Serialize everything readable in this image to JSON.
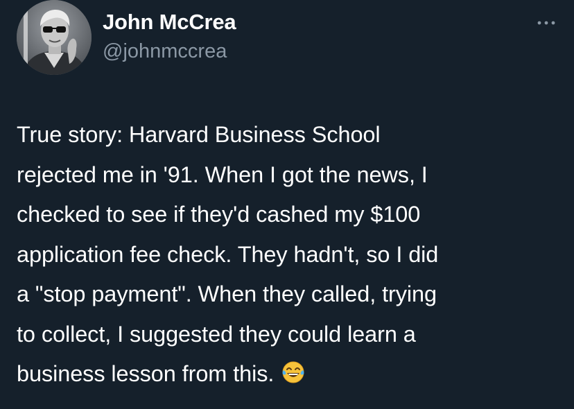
{
  "author": {
    "display_name": "John McCrea",
    "handle": "@johnmccrea",
    "avatar_icon": "profile-photo"
  },
  "menu": {
    "icon": "more-icon"
  },
  "tweet": {
    "text": "True story: Harvard Business School\nrejected me in '91. When I got the news, I\nchecked to see if they'd cashed my $100\napplication fee check. They hadn't, so I did\na \"stop payment\". When they called, trying\nto collect, I suggested they could learn a\nbusiness lesson from this.",
    "emoji_icon": "tears-of-joy-emoji"
  },
  "colors": {
    "background": "#15202b",
    "text": "#ffffff",
    "secondary_text": "#8b98a5"
  }
}
